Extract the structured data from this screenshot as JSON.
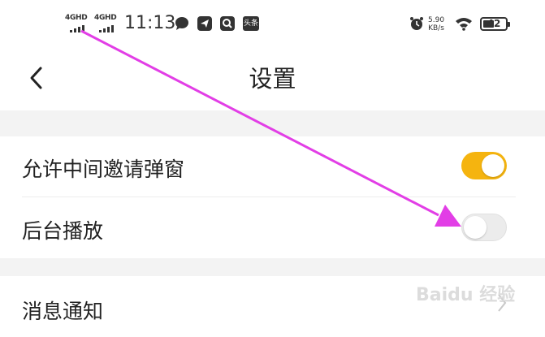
{
  "status_bar": {
    "signal1": "4GHD",
    "signal2": "4GHD",
    "time": "11:13",
    "app_icon_text": "头条",
    "net_speed_value": "5.90",
    "net_speed_unit": "KB/s",
    "battery_level": "42"
  },
  "header": {
    "title": "设置"
  },
  "settings": {
    "invite_popup": {
      "label": "允许中间邀请弹窗",
      "enabled": true
    },
    "background_play": {
      "label": "后台播放",
      "enabled": false
    },
    "notifications": {
      "label": "消息通知"
    }
  },
  "watermark": "Baidu 经验",
  "colors": {
    "toggle_on": "#f5b40f",
    "toggle_off": "#ececec",
    "annotation_arrow": "#e23ee6",
    "section_gap": "#f3f3f3"
  }
}
